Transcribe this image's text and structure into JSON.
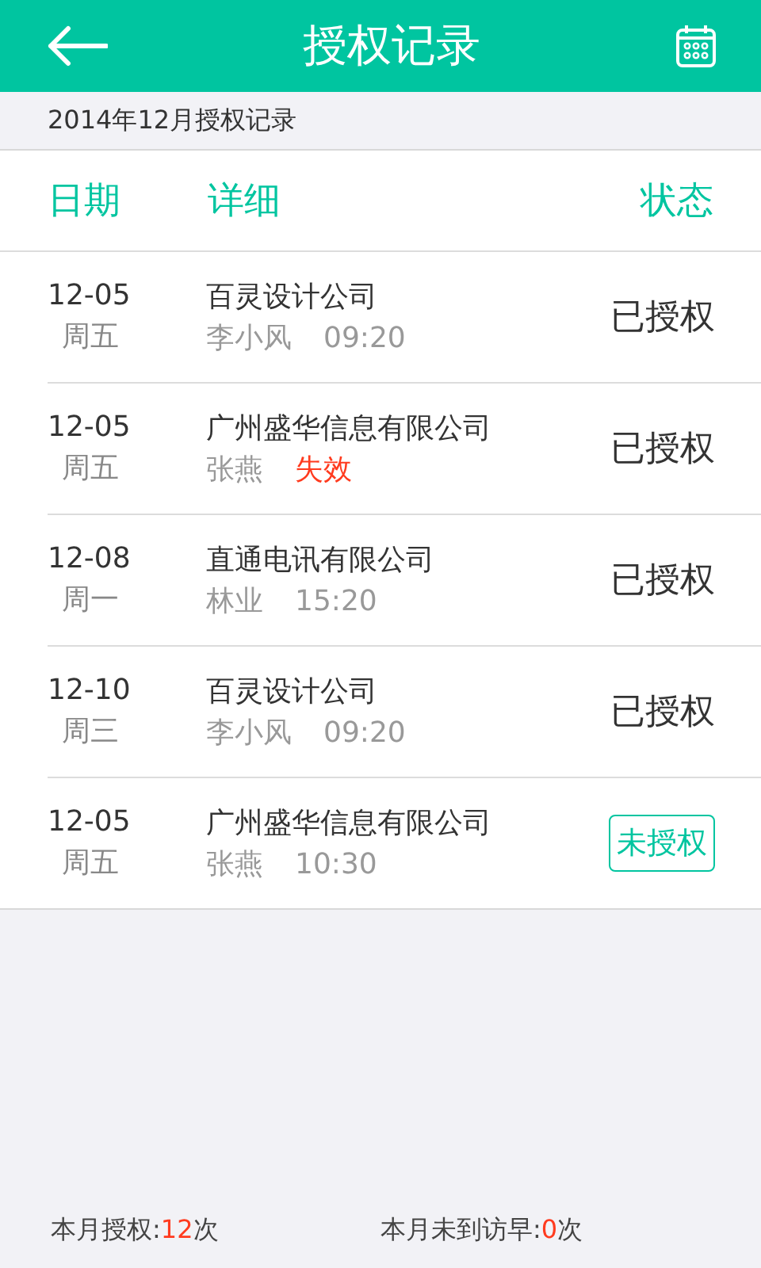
{
  "title": "授权记录",
  "month_label": "2014年12月授权记录",
  "columns": [
    "日期",
    "详细",
    "状态"
  ],
  "records": [
    {
      "date": "12-05",
      "weekday": "周五",
      "company": "百灵设计公司",
      "person": "李小风",
      "note": {
        "kind": "time",
        "text": "09:20"
      },
      "status": "已授权",
      "authorized": true
    },
    {
      "date": "12-05",
      "weekday": "周五",
      "company": "广州盛华信息有限公司",
      "person": "张燕",
      "note": {
        "kind": "expired",
        "text": "失效"
      },
      "status": "已授权",
      "authorized": true
    },
    {
      "date": "12-08",
      "weekday": "周一",
      "company": "直通电讯有限公司",
      "person": "林业",
      "note": {
        "kind": "time",
        "text": "15:20"
      },
      "status": "已授权",
      "authorized": true
    },
    {
      "date": "12-10",
      "weekday": "周三",
      "company": "百灵设计公司",
      "person": "李小风",
      "note": {
        "kind": "time",
        "text": "09:20"
      },
      "status": "已授权",
      "authorized": true
    },
    {
      "date": "12-05",
      "weekday": "周五",
      "company": "广州盛华信息有限公司",
      "person": "张燕",
      "note": {
        "kind": "time",
        "text": "10:30"
      },
      "status": "未授权",
      "authorized": false
    }
  ],
  "summary": [
    {
      "label": "本月授权:",
      "count": "12",
      "unit": "次"
    },
    {
      "label": "本月未到访早:",
      "count": "0",
      "unit": "次"
    }
  ]
}
